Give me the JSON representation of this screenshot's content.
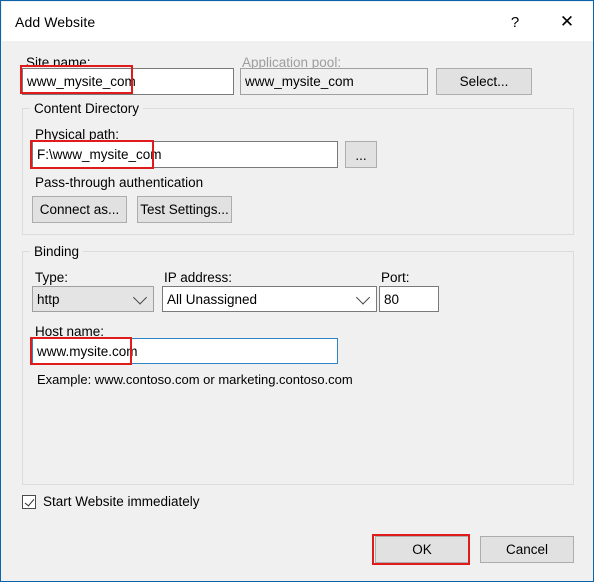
{
  "window": {
    "title": "Add Website",
    "help_icon": "?",
    "close_icon": "✕"
  },
  "site_name": {
    "label": "Site name:",
    "value": "www_mysite_com",
    "placeholder": ""
  },
  "application_pool": {
    "label": "Application pool:",
    "value": "www_mysite_com",
    "select_button": "Select..."
  },
  "content_directory": {
    "group_title": "Content Directory",
    "physical_path_label": "Physical path:",
    "physical_path_value": "F:\\www_mysite_com",
    "browse_button": "...",
    "passthrough_label": "Pass-through authentication",
    "connect_as_button": "Connect as...",
    "test_settings_button": "Test Settings..."
  },
  "binding": {
    "group_title": "Binding",
    "type_label": "Type:",
    "type_value": "http",
    "ip_label": "IP address:",
    "ip_value": "All Unassigned",
    "port_label": "Port:",
    "port_value": "80",
    "host_label": "Host name:",
    "host_value": "www.mysite.com",
    "example_text": "Example: www.contoso.com or marketing.contoso.com"
  },
  "footer": {
    "start_website_label": "Start Website immediately",
    "start_website_checked": true,
    "ok_button": "OK",
    "cancel_button": "Cancel"
  },
  "annotations": {
    "color": "#e01b1b",
    "targets": [
      "site-name-value",
      "physical-path-value",
      "host-name-value",
      "ok-button"
    ]
  }
}
